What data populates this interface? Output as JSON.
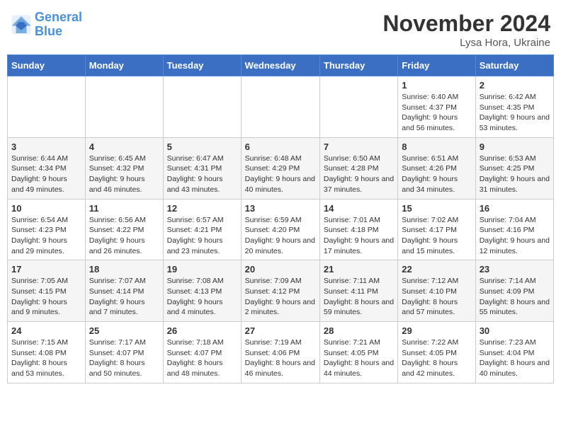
{
  "logo": {
    "text_general": "General",
    "text_blue": "Blue"
  },
  "header": {
    "month": "November 2024",
    "location": "Lysa Hora, Ukraine"
  },
  "weekdays": [
    "Sunday",
    "Monday",
    "Tuesday",
    "Wednesday",
    "Thursday",
    "Friday",
    "Saturday"
  ],
  "weeks": [
    [
      {
        "day": "",
        "info": ""
      },
      {
        "day": "",
        "info": ""
      },
      {
        "day": "",
        "info": ""
      },
      {
        "day": "",
        "info": ""
      },
      {
        "day": "",
        "info": ""
      },
      {
        "day": "1",
        "info": "Sunrise: 6:40 AM\nSunset: 4:37 PM\nDaylight: 9 hours and 56 minutes."
      },
      {
        "day": "2",
        "info": "Sunrise: 6:42 AM\nSunset: 4:35 PM\nDaylight: 9 hours and 53 minutes."
      }
    ],
    [
      {
        "day": "3",
        "info": "Sunrise: 6:44 AM\nSunset: 4:34 PM\nDaylight: 9 hours and 49 minutes."
      },
      {
        "day": "4",
        "info": "Sunrise: 6:45 AM\nSunset: 4:32 PM\nDaylight: 9 hours and 46 minutes."
      },
      {
        "day": "5",
        "info": "Sunrise: 6:47 AM\nSunset: 4:31 PM\nDaylight: 9 hours and 43 minutes."
      },
      {
        "day": "6",
        "info": "Sunrise: 6:48 AM\nSunset: 4:29 PM\nDaylight: 9 hours and 40 minutes."
      },
      {
        "day": "7",
        "info": "Sunrise: 6:50 AM\nSunset: 4:28 PM\nDaylight: 9 hours and 37 minutes."
      },
      {
        "day": "8",
        "info": "Sunrise: 6:51 AM\nSunset: 4:26 PM\nDaylight: 9 hours and 34 minutes."
      },
      {
        "day": "9",
        "info": "Sunrise: 6:53 AM\nSunset: 4:25 PM\nDaylight: 9 hours and 31 minutes."
      }
    ],
    [
      {
        "day": "10",
        "info": "Sunrise: 6:54 AM\nSunset: 4:23 PM\nDaylight: 9 hours and 29 minutes."
      },
      {
        "day": "11",
        "info": "Sunrise: 6:56 AM\nSunset: 4:22 PM\nDaylight: 9 hours and 26 minutes."
      },
      {
        "day": "12",
        "info": "Sunrise: 6:57 AM\nSunset: 4:21 PM\nDaylight: 9 hours and 23 minutes."
      },
      {
        "day": "13",
        "info": "Sunrise: 6:59 AM\nSunset: 4:20 PM\nDaylight: 9 hours and 20 minutes."
      },
      {
        "day": "14",
        "info": "Sunrise: 7:01 AM\nSunset: 4:18 PM\nDaylight: 9 hours and 17 minutes."
      },
      {
        "day": "15",
        "info": "Sunrise: 7:02 AM\nSunset: 4:17 PM\nDaylight: 9 hours and 15 minutes."
      },
      {
        "day": "16",
        "info": "Sunrise: 7:04 AM\nSunset: 4:16 PM\nDaylight: 9 hours and 12 minutes."
      }
    ],
    [
      {
        "day": "17",
        "info": "Sunrise: 7:05 AM\nSunset: 4:15 PM\nDaylight: 9 hours and 9 minutes."
      },
      {
        "day": "18",
        "info": "Sunrise: 7:07 AM\nSunset: 4:14 PM\nDaylight: 9 hours and 7 minutes."
      },
      {
        "day": "19",
        "info": "Sunrise: 7:08 AM\nSunset: 4:13 PM\nDaylight: 9 hours and 4 minutes."
      },
      {
        "day": "20",
        "info": "Sunrise: 7:09 AM\nSunset: 4:12 PM\nDaylight: 9 hours and 2 minutes."
      },
      {
        "day": "21",
        "info": "Sunrise: 7:11 AM\nSunset: 4:11 PM\nDaylight: 8 hours and 59 minutes."
      },
      {
        "day": "22",
        "info": "Sunrise: 7:12 AM\nSunset: 4:10 PM\nDaylight: 8 hours and 57 minutes."
      },
      {
        "day": "23",
        "info": "Sunrise: 7:14 AM\nSunset: 4:09 PM\nDaylight: 8 hours and 55 minutes."
      }
    ],
    [
      {
        "day": "24",
        "info": "Sunrise: 7:15 AM\nSunset: 4:08 PM\nDaylight: 8 hours and 53 minutes."
      },
      {
        "day": "25",
        "info": "Sunrise: 7:17 AM\nSunset: 4:07 PM\nDaylight: 8 hours and 50 minutes."
      },
      {
        "day": "26",
        "info": "Sunrise: 7:18 AM\nSunset: 4:07 PM\nDaylight: 8 hours and 48 minutes."
      },
      {
        "day": "27",
        "info": "Sunrise: 7:19 AM\nSunset: 4:06 PM\nDaylight: 8 hours and 46 minutes."
      },
      {
        "day": "28",
        "info": "Sunrise: 7:21 AM\nSunset: 4:05 PM\nDaylight: 8 hours and 44 minutes."
      },
      {
        "day": "29",
        "info": "Sunrise: 7:22 AM\nSunset: 4:05 PM\nDaylight: 8 hours and 42 minutes."
      },
      {
        "day": "30",
        "info": "Sunrise: 7:23 AM\nSunset: 4:04 PM\nDaylight: 8 hours and 40 minutes."
      }
    ]
  ]
}
